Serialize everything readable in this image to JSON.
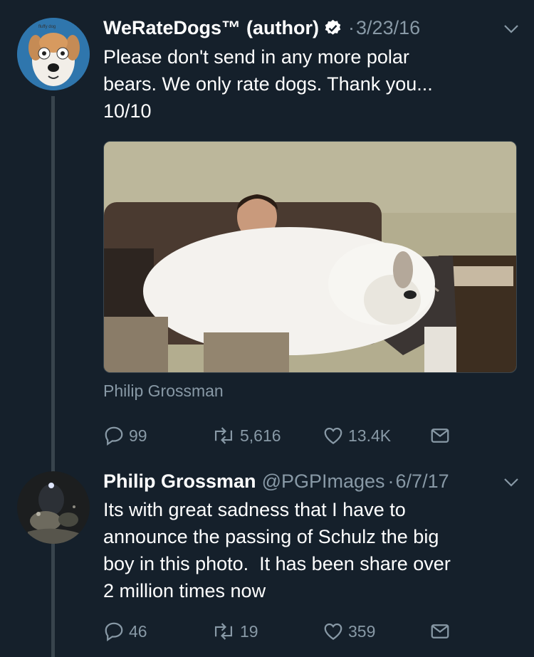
{
  "tweet1": {
    "display_name": "WeRateDogs™",
    "author_tag": "(author)",
    "separator": "·",
    "date": "3/23/16",
    "text": "Please don't send in any more polar\nbears. We only rate dogs. Thank you...\n10/10",
    "media_credit": "Philip Grossman",
    "avatar_text": "fluffy dog",
    "replies": "99",
    "retweets": "5,616",
    "likes": "13.4K",
    "icons": [
      "verified-icon",
      "chevron-down-icon",
      "reply-icon",
      "retweet-icon",
      "like-icon",
      "message-icon"
    ]
  },
  "tweet2": {
    "display_name": "Philip Grossman",
    "handle": "@PGPImages",
    "separator": "·",
    "date": "6/7/17",
    "text": "Its with great sadness that I have to\nannounce the passing of Schulz the big\nboy in this photo.  It has been share over\n2 million times now",
    "replies": "46",
    "retweets": "19",
    "likes": "359"
  },
  "colors": {
    "background": "#15202b",
    "muted": "#8899a6",
    "thread_line": "#38444d",
    "text": "#ffffff"
  }
}
